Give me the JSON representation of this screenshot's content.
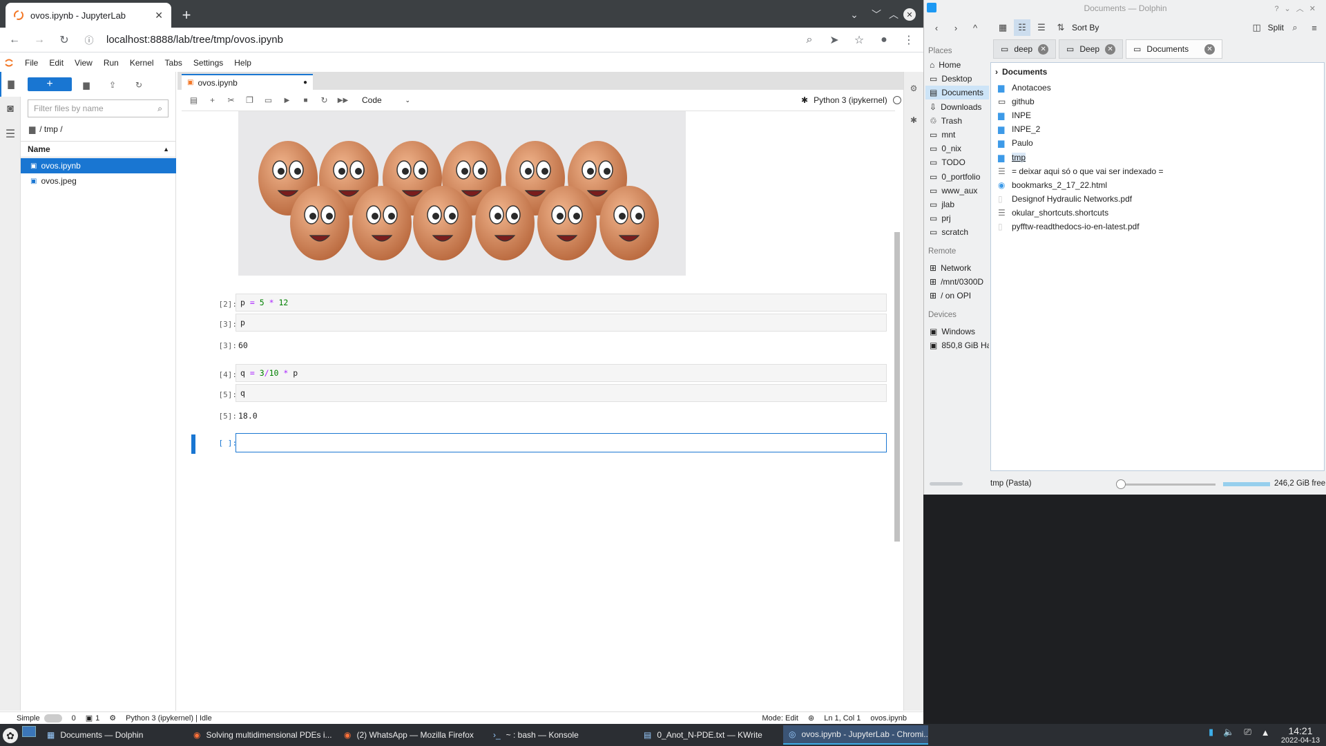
{
  "browser": {
    "tab_title": "ovos.ipynb - JupyterLab",
    "url": "localhost:8888/lab/tree/tmp/ovos.ipynb"
  },
  "jupyter": {
    "menu": [
      "File",
      "Edit",
      "View",
      "Run",
      "Kernel",
      "Tabs",
      "Settings",
      "Help"
    ],
    "filter_placeholder": "Filter files by name",
    "breadcrumb": "/ tmp /",
    "name_header": "Name",
    "files": [
      {
        "name": "ovos.ipynb",
        "type": "notebook",
        "selected": true
      },
      {
        "name": "ovos.jpeg",
        "type": "image",
        "selected": false
      }
    ],
    "notebook_tab": "ovos.ipynb",
    "cell_type": "Code",
    "kernel_name": "Python 3 (ipykernel)",
    "cells": [
      {
        "in": "[2]:",
        "code": "p = 5 * 12"
      },
      {
        "in": "[3]:",
        "code": "p",
        "out_prompt": "[3]:",
        "out": "60"
      },
      {
        "in": "[4]:",
        "code": "q = 3/10 * p"
      },
      {
        "in": "[5]:",
        "code": "q",
        "out_prompt": "[5]:",
        "out": "18.0"
      },
      {
        "in": "[ ]:",
        "code": ""
      }
    ],
    "status": {
      "mode_label": "Simple",
      "terminals": "0",
      "kernels": "1",
      "kernel_status": "Python 3 (ipykernel) | Idle",
      "mode": "Mode: Edit",
      "position": "Ln 1, Col 1",
      "file": "ovos.ipynb"
    }
  },
  "dolphin": {
    "title": "Documents — Dolphin",
    "sort_by": "Sort By",
    "split": "Split",
    "tabs": [
      "deep",
      "Deep",
      "Documents"
    ],
    "places_header": "Places",
    "places": [
      "Home",
      "Desktop",
      "Documents",
      "Downloads",
      "Trash",
      "mnt",
      "0_nix",
      "TODO",
      "0_portfolio",
      "www_aux",
      "jlab",
      "prj",
      "scratch"
    ],
    "remote_header": "Remote",
    "remote": [
      "Network",
      "/mnt/0300D",
      "/ on OPI"
    ],
    "devices_header": "Devices",
    "devices": [
      "Windows",
      "850,8 GiB Ha"
    ],
    "breadcrumb": "Documents",
    "items": [
      {
        "name": "Anotacoes",
        "kind": "folder-blue"
      },
      {
        "name": "github",
        "kind": "folder"
      },
      {
        "name": "INPE",
        "kind": "folder-blue"
      },
      {
        "name": "INPE_2",
        "kind": "folder-blue"
      },
      {
        "name": "Paulo",
        "kind": "folder-blue"
      },
      {
        "name": "tmp",
        "kind": "folder-blue"
      },
      {
        "name": "= deixar aqui só o que vai ser indexado =",
        "kind": "text"
      },
      {
        "name": "bookmarks_2_17_22.html",
        "kind": "html"
      },
      {
        "name": "Designof Hydraulic Networks.pdf",
        "kind": "pdf"
      },
      {
        "name": "okular_shortcuts.shortcuts",
        "kind": "text"
      },
      {
        "name": "pyfftw-readthedocs-io-en-latest.pdf",
        "kind": "pdf"
      }
    ],
    "status_left": "tmp (Pasta)",
    "free_space": "246,2 GiB free"
  },
  "taskbar": {
    "tasks": [
      "Documents — Dolphin",
      "Solving multidimensional PDEs i...",
      "(2) WhatsApp — Mozilla Firefox",
      "~ : bash — Konsole",
      "0_Anot_N-PDE.txt — KWrite",
      "ovos.ipynb - JupyterLab - Chromi..."
    ],
    "time": "14:21",
    "date": "2022-04-13"
  }
}
